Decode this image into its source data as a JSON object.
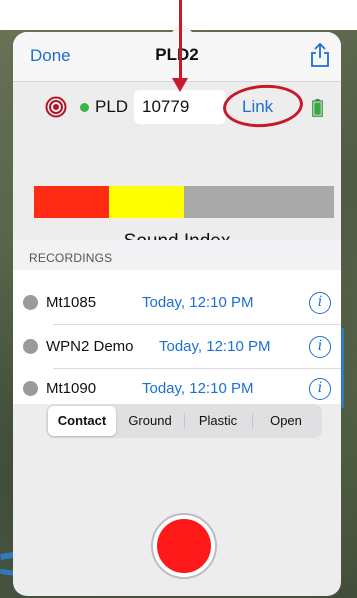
{
  "nav": {
    "done_label": "Done",
    "title": "PLD2"
  },
  "device": {
    "prefix_label": "PLD",
    "id_value": "10779",
    "link_label": "Link",
    "status_color": "#3bb54a"
  },
  "sound_index": {
    "label": "Sound Index",
    "segments": [
      {
        "color": "#ff2a12",
        "fraction": 0.25
      },
      {
        "color": "#ffff00",
        "fraction": 0.25
      },
      {
        "color": "#a9a9a9",
        "fraction": 0.5
      }
    ]
  },
  "recordings": {
    "header": "RECORDINGS",
    "items": [
      {
        "name": "Mt1085",
        "time": "Today, 12:10 PM"
      },
      {
        "name": "WPN2 Demo",
        "time": "Today, 12:10 PM"
      },
      {
        "name": "Mt1090",
        "time": "Today, 12:10 PM"
      }
    ]
  },
  "surface": {
    "options": [
      "Contact",
      "Ground",
      "Plastic",
      "Open"
    ],
    "selected": "Contact"
  },
  "colors": {
    "accent": "#1b6fd6",
    "annotation": "#c8192b",
    "record": "#ff1a1a"
  },
  "icons": {
    "share": "share-icon",
    "target": "target-icon",
    "battery": "battery-icon",
    "info": "info-icon",
    "record": "record-icon"
  }
}
